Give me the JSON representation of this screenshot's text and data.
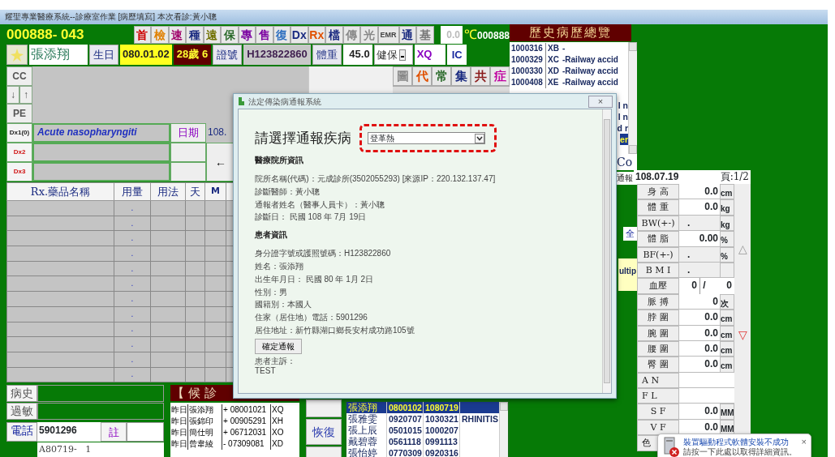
{
  "window": {
    "title": "耀聖專業醫療系統--診療室作業 [病歷填寫] 本次看診:黃小聰"
  },
  "header": {
    "chart_no": "000888- 043",
    "tools": [
      {
        "label": "首",
        "color": "#cc0000"
      },
      {
        "label": "檢",
        "color": "#e08000"
      },
      {
        "label": "速",
        "color": "#a0006a"
      },
      {
        "label": "種",
        "color": "#1a2a80"
      },
      {
        "label": "遠",
        "color": "#707000"
      },
      {
        "label": "保",
        "color": "#2a6a2a"
      },
      {
        "label": "專",
        "color": "#7a00a0"
      },
      {
        "label": "售",
        "color": "#7a00a0"
      },
      {
        "label": "復",
        "color": "#3070c0"
      },
      {
        "label": "Dx",
        "color": "#1a2a80"
      },
      {
        "label": "Rx",
        "color": "#e05000"
      },
      {
        "label": "檔",
        "color": "#1a2a80"
      },
      {
        "label": "傳",
        "color": "#888888"
      },
      {
        "label": "光",
        "color": "#888888"
      },
      {
        "label": "EMR",
        "color": "#444444"
      },
      {
        "label": "通",
        "color": "#1a2a80"
      },
      {
        "label": "基",
        "color": "#777777"
      }
    ],
    "temperature": "0.0",
    "temp_unit": "℃",
    "doctor_code": "000888"
  },
  "patient": {
    "name": "張添翔",
    "birth_label": "生日",
    "birth": "080.01.02",
    "age": "28歲 6",
    "id_label": "證號",
    "id": "H123822860",
    "weight_label": "體重",
    "weight": "45.0",
    "insurance": "健保",
    "code": "XQ",
    "card": "IC"
  },
  "cc_label": "CC",
  "arrows": [
    "↓",
    "↑"
  ],
  "pe_label": "PE",
  "side_tools": [
    {
      "label": "圖",
      "color": "#888888"
    },
    {
      "label": "代",
      "color": "#e05000"
    },
    {
      "label": "常",
      "color": "#2a6a2a"
    },
    {
      "label": "集",
      "color": "#1a2a80"
    },
    {
      "label": "共",
      "color": "#8a1a1a"
    },
    {
      "label": "症",
      "color": "#c000a0"
    }
  ],
  "diagnoses": [
    {
      "label": "Dx1(0)",
      "text": "Acute nasopharyngiti"
    },
    {
      "label": "Dx2"
    },
    {
      "label": "Dx3"
    }
  ],
  "date_label": "日期",
  "date": "108.",
  "back": "←",
  "rx": {
    "columns": [
      "Rx.藥品名稱",
      "用量",
      "用法",
      "天",
      "M"
    ],
    "rows": [
      {
        "dose": "."
      },
      {
        "dose": "."
      },
      {
        "dose": "."
      },
      {
        "dose": "."
      },
      {
        "dose": "."
      },
      {
        "dose": "."
      },
      {
        "dose": "."
      },
      {
        "dose": "."
      },
      {
        "dose": "."
      },
      {
        "dose": "."
      },
      {
        "dose": "."
      },
      {
        "dose": "."
      }
    ]
  },
  "medical_history_label": "病史",
  "allergy_label": "過敏",
  "phone": {
    "label": "電話",
    "value": "5901296",
    "note": "註"
  },
  "address": {
    "value": "A80719-   1"
  },
  "waiting": {
    "title": "【 候 診",
    "rows": [
      {
        "day": "昨日",
        "name": "張添翔",
        "sign": "+",
        "code": "08001021",
        "tag": "XQ"
      },
      {
        "day": "昨日",
        "name": "張錦印",
        "sign": "+",
        "code": "00905291",
        "tag": "XH"
      },
      {
        "day": "昨日",
        "name": "簡仕明",
        "sign": "+",
        "code": "06712031",
        "tag": "XO"
      },
      {
        "day": "昨日",
        "name": "曾韋綾",
        "sign": "-",
        "code": "07309081",
        "tag": "XD"
      }
    ]
  },
  "restore": "恢復",
  "patients": [
    {
      "name": "張添翔",
      "birth": "0800102",
      "visit": "1080719",
      "selected": true
    },
    {
      "name": "張雅雯",
      "birth": "0920707",
      "visit": "1030321",
      "diagnosis": "RHINITIS",
      "selected": false
    },
    {
      "name": "張上辰",
      "birth": "0501015",
      "visit": "1000207",
      "selected": false
    },
    {
      "name": "戴碧蓉",
      "birth": "0561118",
      "visit": "0991113",
      "selected": false
    },
    {
      "name": "張怡婷",
      "birth": "0770309",
      "visit": "0920316",
      "selected": false
    }
  ],
  "history_overview": {
    "title": "歷史病歷總覽",
    "rows": [
      {
        "date": "1000316",
        "code": "XB",
        "text": "-"
      },
      {
        "date": "1000329",
        "code": "XC",
        "text": "-Railway accid"
      },
      {
        "date": "1000330",
        "code": "XD",
        "text": "-Railway accid"
      },
      {
        "date": "1000408",
        "code": "XE",
        "text": "-Railway accid"
      }
    ],
    "tails": [
      {
        "text": "l n",
        "selected": false
      },
      {
        "text": "l n",
        "selected": false
      },
      {
        "text": "d r",
        "selected": false
      },
      {
        "text": "er",
        "selected": true
      }
    ]
  },
  "behind": [
    "Co",
    "通報",
    "全",
    "ultip"
  ],
  "vitals": {
    "date": "108.07.19",
    "page": "頁:1/2",
    "up": "△",
    "down": "▽",
    "rows": [
      {
        "label": "身 高",
        "kind": "input",
        "value": "0.0",
        "unit": "cm"
      },
      {
        "label": "體 重",
        "kind": "input",
        "value": "0.0",
        "unit": "kg"
      },
      {
        "label": "BW(+-)",
        "kind": "computed",
        "value": ".",
        "unit": "kg"
      },
      {
        "label": "體 脂",
        "kind": "input",
        "value": "0.00",
        "unit": "%"
      },
      {
        "label": "BF(+-)",
        "kind": "computed",
        "value": ".",
        "unit": "%"
      },
      {
        "label": "B M I",
        "kind": "computed",
        "value": "."
      },
      {
        "label": "血壓",
        "kind": "bp",
        "value": "0",
        "separator": "/",
        "value2": "0"
      },
      {
        "label": "脈 搏",
        "kind": "input",
        "value": "0",
        "unit": "次"
      },
      {
        "label": "脖 圍",
        "kind": "input",
        "value": "0.0",
        "unit": "cm"
      },
      {
        "label": "腕 圍",
        "kind": "input",
        "value": "0.0",
        "unit": "cm"
      },
      {
        "label": "腰 圍",
        "kind": "input",
        "value": "0.0",
        "unit": "cm"
      },
      {
        "label": "臀 圍",
        "kind": "input",
        "value": "0.0",
        "unit": "cm"
      },
      {
        "label": "A N",
        "kind": "wide"
      },
      {
        "label": "F L",
        "kind": "wide"
      },
      {
        "label": "S F",
        "kind": "input",
        "value": "0.0",
        "unit": "MM"
      },
      {
        "label": "V F",
        "kind": "input",
        "value": "0.0",
        "unit": "MM"
      },
      {
        "label": "色",
        "kind": "wide"
      }
    ]
  },
  "dialog": {
    "title": "法定傳染病通報系統",
    "prompt": "請選擇通報疾病",
    "disease": "登革熱",
    "sections": [
      {
        "heading": "醫療院所資訊",
        "lines": [
          "院所名稱(代碼)：元成診所(3502055293) [來源IP：220.132.137.47]",
          "診斷醫師：黃小聰",
          "通報者姓名（醫事人員卡）：黃小聰",
          "診斷日： 民國 108 年 7月 19日"
        ]
      },
      {
        "heading": "患者資訊",
        "lines": [
          "身分證字號或護照號碼：H123822860",
          "姓名：張添翔",
          "出生年月日： 民國 80 年 1月 2日",
          "性別：男",
          "國籍別：本國人",
          "住家（居住地）電話：5901296",
          "居住地址：新竹縣湖口鄉長安村成功路105號"
        ]
      }
    ],
    "close": "×",
    "submit": "確定通報",
    "complaint_label": "患者主訴：",
    "complaint": "TEST"
  },
  "notification": {
    "title": "裝置驅動程式軟體安裝不成功",
    "detail": "請按一下此處以取得詳細資訊。",
    "close": "×"
  }
}
